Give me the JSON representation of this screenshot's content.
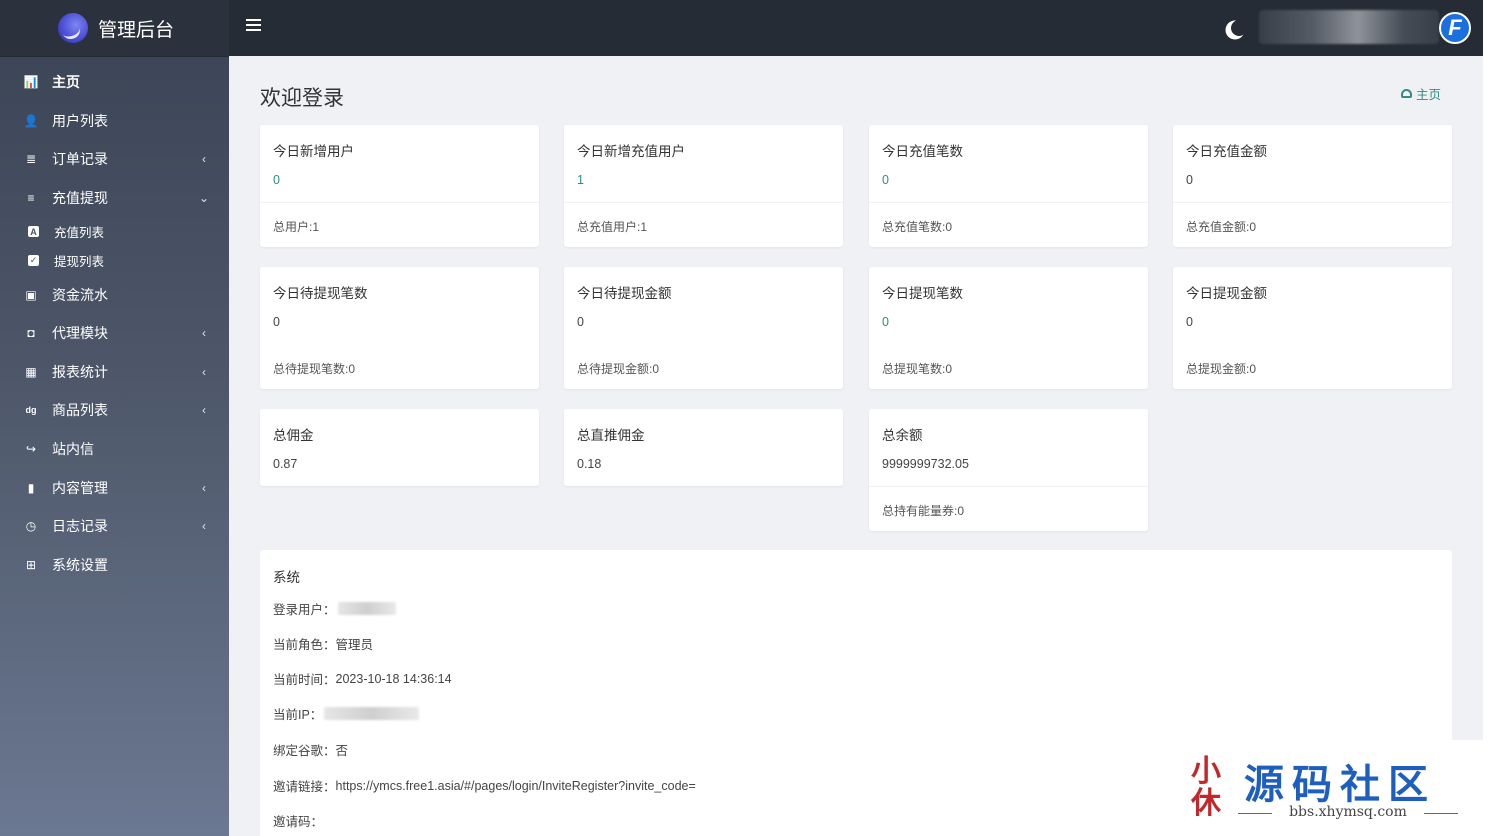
{
  "brand": {
    "title": "管理后台"
  },
  "sidebar": {
    "items": [
      {
        "label": "主页",
        "icon": "bar-chart-icon",
        "glyph": "📊",
        "chevron": ""
      },
      {
        "label": "用户列表",
        "icon": "user-icon",
        "glyph": "👤",
        "chevron": ""
      },
      {
        "label": "订单记录",
        "icon": "list-icon",
        "glyph": "≣",
        "chevron": "‹"
      },
      {
        "label": "充值提现",
        "icon": "menu-icon",
        "glyph": "≡",
        "chevron": "⌄"
      },
      {
        "label": "资金流水",
        "icon": "money-icon",
        "glyph": "▣",
        "chevron": ""
      },
      {
        "label": "代理模块",
        "icon": "contact-icon",
        "glyph": "◘",
        "chevron": "‹"
      },
      {
        "label": "报表统计",
        "icon": "calendar-icon",
        "glyph": "▦",
        "chevron": "‹"
      },
      {
        "label": "商品列表",
        "icon": "digg-icon",
        "glyph": "dg",
        "chevron": "‹"
      },
      {
        "label": "站内信",
        "icon": "share-icon",
        "glyph": "↪",
        "chevron": ""
      },
      {
        "label": "内容管理",
        "icon": "bookmark-icon",
        "glyph": "▮",
        "chevron": "‹"
      },
      {
        "label": "日志记录",
        "icon": "clock-icon",
        "glyph": "◷",
        "chevron": "‹"
      },
      {
        "label": "系统设置",
        "icon": "windows-icon",
        "glyph": "⊞",
        "chevron": ""
      }
    ],
    "subitems": [
      {
        "label": "充值列表",
        "icon": "letter-a-icon",
        "glyph": "A"
      },
      {
        "label": "提现列表",
        "icon": "check-square-icon",
        "glyph": "✓"
      }
    ]
  },
  "page": {
    "title": "欢迎登录",
    "breadcrumb": "主页"
  },
  "stats": [
    {
      "label": "今日新增用户",
      "value": "0",
      "footer": "总用户:1",
      "teal": true
    },
    {
      "label": "今日新增充值用户",
      "value": "1",
      "footer": "总充值用户:1",
      "teal": true
    },
    {
      "label": "今日充值笔数",
      "value": "0",
      "footer": "总充值笔数:0",
      "teal": true
    },
    {
      "label": "今日充值金额",
      "value": "0",
      "footer": "总充值金额:0",
      "teal": false
    },
    {
      "label": "今日待提现笔数",
      "value": "0",
      "footer": "总待提现笔数:0",
      "teal": false
    },
    {
      "label": "今日待提现金额",
      "value": "0",
      "footer": "总待提现金额:0",
      "teal": false
    },
    {
      "label": "今日提现笔数",
      "value": "0",
      "footer": "总提现笔数:0",
      "teal": true
    },
    {
      "label": "今日提现金额",
      "value": "0",
      "footer": "总提现金额:0",
      "teal": false
    },
    {
      "label": "总佣金",
      "value": "0.87",
      "footer": "",
      "teal": false
    },
    {
      "label": "总直推佣金",
      "value": "0.18",
      "footer": "",
      "teal": false
    },
    {
      "label": "总余额",
      "value": "9999999732.05",
      "footer": "总持有能量券:0",
      "teal": false
    }
  ],
  "system": {
    "title": "系统",
    "rows": [
      {
        "label": "登录用户：",
        "value": ""
      },
      {
        "label": "当前角色：",
        "value": "管理员"
      },
      {
        "label": "当前时间：",
        "value": "2023-10-18 14:36:14"
      },
      {
        "label": "当前IP：",
        "value": ""
      },
      {
        "label": "绑定谷歌：",
        "value": "否"
      },
      {
        "label": "邀请链接：",
        "value": "https://ymcs.free1.asia/#/pages/login/InviteRegister?invite_code="
      },
      {
        "label": "邀请码：",
        "value": ""
      }
    ]
  },
  "watermark": {
    "badge_top": "小",
    "badge_bottom": "休",
    "title": "源码社区",
    "url": "bbs.xhymsq.com"
  },
  "colors": {
    "sidebar_top": "#3a4354",
    "topbar": "#262c35",
    "accent_teal": "#2f8d82",
    "content_bg": "#f0f1f5"
  }
}
